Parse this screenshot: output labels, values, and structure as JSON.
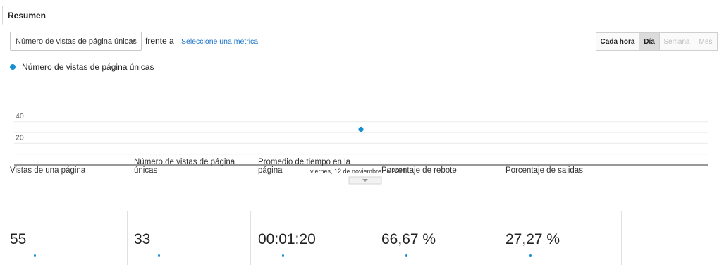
{
  "tabs": {
    "summary_label": "Resumen"
  },
  "controls": {
    "metric_select_value": "Número de vistas de página únicas",
    "versus_text": "frente a",
    "select_metric_link": "Seleccione una métrica",
    "granularity": [
      {
        "label": "Cada hora",
        "state": "normal"
      },
      {
        "label": "Día",
        "state": "active"
      },
      {
        "label": "Semana",
        "state": "disabled"
      },
      {
        "label": "Mes",
        "state": "disabled"
      }
    ]
  },
  "legend": {
    "series_label": "Número de vistas de página únicas"
  },
  "colors": {
    "series": "#1a8fd0",
    "link": "#1a73c7"
  },
  "chart_data": {
    "type": "scatter",
    "x": [
      "viernes, 12 de noviembre de 2021"
    ],
    "series": [
      {
        "name": "Número de vistas de página únicas",
        "values": [
          33
        ]
      }
    ],
    "y_ticks": [
      20,
      40
    ],
    "ylim": [
      0,
      43
    ],
    "xlabel": "",
    "ylabel": "",
    "grid": true
  },
  "metrics": [
    {
      "label": "Vistas de una página",
      "value": "55"
    },
    {
      "label": "Número de vistas de página únicas",
      "value": "33"
    },
    {
      "label": "Promedio de tiempo en la página",
      "value": "00:01:20"
    },
    {
      "label": "Porcentaje de rebote",
      "value": "66,67 %"
    },
    {
      "label": "Porcentaje de salidas",
      "value": "27,27 %"
    }
  ]
}
